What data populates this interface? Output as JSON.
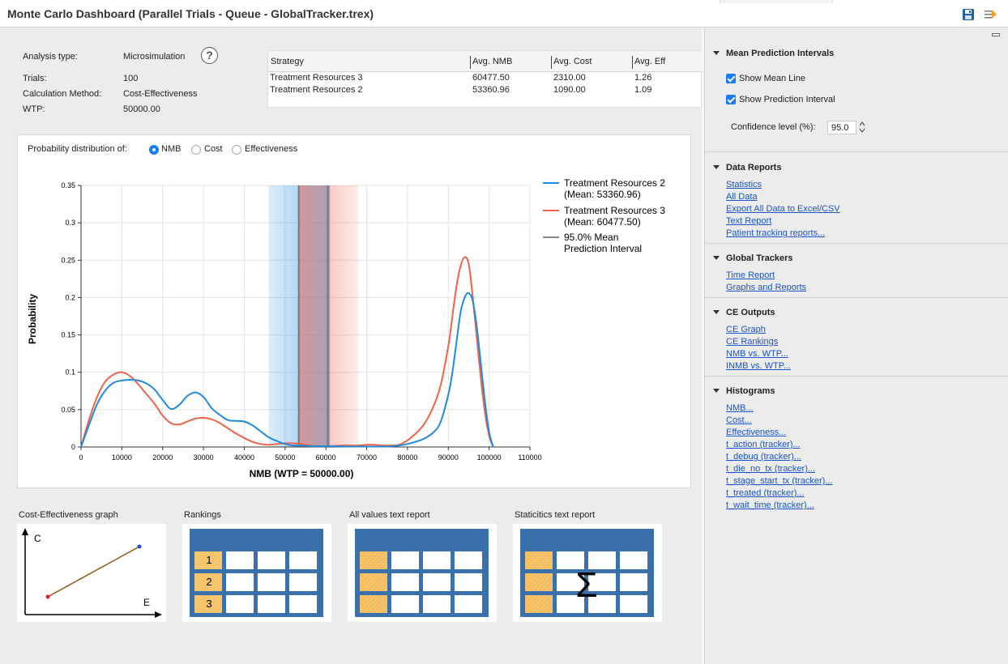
{
  "window": {
    "title": "Monte Carlo Dashboard (Parallel Trials - Queue - GlobalTracker.trex)"
  },
  "toolbar": {
    "save_icon": "save-icon",
    "export_icon": "export-icon"
  },
  "info": {
    "analysis_type_label": "Analysis type:",
    "analysis_type_value": "Microsimulation",
    "trials_label": "Trials:",
    "trials_value": "100",
    "calc_label": "Calculation Method:",
    "calc_value": "Cost-Effectiveness",
    "wtp_label": "WTP:",
    "wtp_value": "50000.00",
    "help": "?"
  },
  "strategy_table": {
    "headers": [
      "Strategy",
      "Avg. NMB",
      "Avg. Cost",
      "Avg. Eff"
    ],
    "rows": [
      [
        "Treatment Resources 3",
        "60477.50",
        "2310.00",
        "1.26"
      ],
      [
        "Treatment Resources 2",
        "53360.96",
        "1090.00",
        "1.09"
      ]
    ]
  },
  "distribution": {
    "label": "Probability distribution of:",
    "options": [
      "NMB",
      "Cost",
      "Effectiveness"
    ],
    "selected": "NMB"
  },
  "chart_data": {
    "type": "line",
    "xlabel": "NMB (WTP = 50000.00)",
    "ylabel": "Probability",
    "xlim": [
      0,
      110000
    ],
    "ylim": [
      0,
      0.35
    ],
    "xticks": [
      0,
      10000,
      20000,
      30000,
      40000,
      50000,
      60000,
      70000,
      80000,
      90000,
      100000,
      110000
    ],
    "yticks": [
      0,
      0.05,
      0.1,
      0.15,
      0.2,
      0.25,
      0.3,
      0.35
    ],
    "ytick_labels": [
      "0",
      "0.05",
      "0.1",
      "0.15",
      "0.2",
      "0.25",
      "0.3",
      "0.35"
    ],
    "grid": true,
    "legend_position": "right",
    "series": [
      {
        "name": "Treatment Resources 2",
        "legend_lines": [
          "Treatment Resources 2",
          "(Mean: 53360.96)"
        ],
        "color": "#1f8ae0",
        "x": [
          0,
          2000,
          4000,
          6000,
          8000,
          10000,
          12000,
          14000,
          16000,
          18000,
          20000,
          22000,
          24000,
          26000,
          28000,
          30000,
          32000,
          34000,
          36000,
          38000,
          40000,
          42000,
          44000,
          46000,
          48000,
          50000,
          52000,
          54000,
          56000,
          58000,
          60000,
          62000,
          64000,
          66000,
          68000,
          70000,
          72000,
          74000,
          76000,
          78000,
          80000,
          82000,
          84000,
          86000,
          88000,
          90000,
          91000,
          92000,
          93000,
          94000,
          95000,
          96000,
          97000,
          98000,
          99000,
          100000,
          101000
        ],
        "y": [
          0,
          0.03,
          0.058,
          0.076,
          0.086,
          0.089,
          0.09,
          0.089,
          0.085,
          0.077,
          0.063,
          0.051,
          0.056,
          0.068,
          0.073,
          0.067,
          0.052,
          0.043,
          0.036,
          0.035,
          0.034,
          0.029,
          0.021,
          0.013,
          0.008,
          0.004,
          0.002,
          0.002,
          0.001,
          0.001,
          0.001,
          0.001,
          0.0005,
          0.0005,
          0.0005,
          0.0005,
          0.0005,
          0.0005,
          0.0008,
          0.002,
          0.004,
          0.007,
          0.011,
          0.018,
          0.032,
          0.07,
          0.1,
          0.14,
          0.18,
          0.2,
          0.206,
          0.195,
          0.16,
          0.11,
          0.06,
          0.02,
          0
        ]
      },
      {
        "name": "Treatment Resources 3",
        "legend_lines": [
          "Treatment Resources 3",
          "(Mean: 60477.50)"
        ],
        "color": "#f0624a",
        "x": [
          0,
          2000,
          4000,
          6000,
          8000,
          10000,
          12000,
          14000,
          16000,
          18000,
          20000,
          22000,
          24000,
          26000,
          28000,
          30000,
          32000,
          34000,
          36000,
          38000,
          40000,
          42000,
          44000,
          46000,
          48000,
          50000,
          52000,
          54000,
          56000,
          58000,
          60000,
          62000,
          64000,
          66000,
          68000,
          70000,
          72000,
          74000,
          76000,
          78000,
          80000,
          82000,
          84000,
          86000,
          88000,
          90000,
          91000,
          92000,
          93000,
          94000,
          95000,
          96000,
          97000,
          98000,
          99000,
          100000,
          101000
        ],
        "y": [
          0,
          0.037,
          0.068,
          0.088,
          0.097,
          0.1,
          0.095,
          0.084,
          0.071,
          0.058,
          0.042,
          0.032,
          0.03,
          0.034,
          0.038,
          0.039,
          0.037,
          0.032,
          0.025,
          0.018,
          0.012,
          0.007,
          0.004,
          0.003,
          0.004,
          0.005,
          0.005,
          0.004,
          0.002,
          0.001,
          0.001,
          0.0015,
          0.002,
          0.002,
          0.002,
          0.003,
          0.003,
          0.002,
          0.002,
          0.003,
          0.009,
          0.018,
          0.03,
          0.05,
          0.08,
          0.135,
          0.175,
          0.215,
          0.242,
          0.254,
          0.245,
          0.2,
          0.145,
          0.09,
          0.045,
          0.015,
          0
        ]
      }
    ],
    "intervals": [
      {
        "for": "Treatment Resources 2",
        "x0": 46000,
        "x1": 61000,
        "color": "#1f8ae0"
      },
      {
        "for": "Treatment Resources 3",
        "x0": 53360,
        "x1": 68000,
        "color": "#f0624a"
      }
    ],
    "mean_lines": [
      53360.96,
      60477.5
    ],
    "interval_legend_lines": [
      "95.0% Mean",
      "Prediction Interval"
    ],
    "interval_legend_color": "#888888"
  },
  "thumbnails": {
    "ce_graph_label": "Cost-Effectiveness graph",
    "rankings_label": "Rankings",
    "all_values_label": "All values text report",
    "statistics_label": "Staticitics text report",
    "ce_axis_c": "C",
    "ce_axis_e": "E",
    "ranks": [
      "1",
      "2",
      "3"
    ],
    "sigma": "Σ"
  },
  "sidebar": {
    "mpi_title": "Mean Prediction Intervals",
    "show_mean_line": "Show Mean Line",
    "show_prediction_interval": "Show Prediction Interval",
    "confidence_label": "Confidence level (%):",
    "confidence_value": "95.0",
    "data_reports_title": "Data Reports",
    "data_reports_links": [
      "Statistics",
      "All Data",
      "Export All Data to Excel/CSV",
      "Text Report",
      "Patient tracking reports..."
    ],
    "global_trackers_title": "Global Trackers",
    "global_trackers_links": [
      "Time Report",
      "Graphs and Reports"
    ],
    "ce_outputs_title": "CE Outputs",
    "ce_outputs_links": [
      "CE Graph",
      "CE Rankings",
      "NMB vs. WTP...",
      "INMB vs. WTP..."
    ],
    "histograms_title": "Histograms",
    "histograms_links": [
      "NMB...",
      "Cost...",
      "Effectiveness...",
      "t_action (tracker)...",
      "t_debug (tracker)...",
      "t_die_no_tx (tracker)...",
      "t_stage_start_tx (tracker)...",
      "t_treated (tracker)...",
      "t_wait_time (tracker)..."
    ]
  }
}
